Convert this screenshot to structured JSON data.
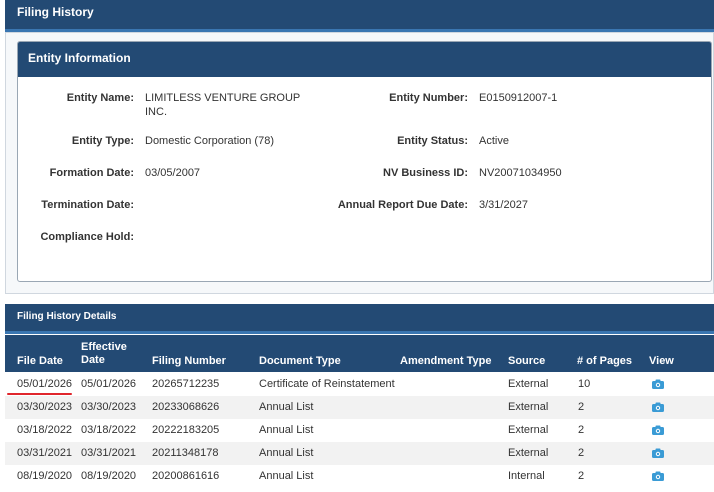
{
  "page_title": "Filing History",
  "entity_section": {
    "title": "Entity Information",
    "fields": {
      "entity_name": {
        "label": "Entity Name:",
        "value_line1": "LIMITLESS VENTURE GROUP",
        "value_line2": "INC."
      },
      "entity_number": {
        "label": "Entity Number:",
        "value": "E0150912007-1"
      },
      "entity_type": {
        "label": "Entity Type:",
        "value": "Domestic Corporation (78)"
      },
      "entity_status": {
        "label": "Entity Status:",
        "value": "Active"
      },
      "formation_date": {
        "label": "Formation Date:",
        "value": "03/05/2007"
      },
      "nv_business_id": {
        "label": "NV Business ID:",
        "value": "NV20071034950"
      },
      "termination_date": {
        "label": "Termination Date:",
        "value": ""
      },
      "annual_report_due": {
        "label": "Annual Report Due Date:",
        "value": "3/31/2027"
      },
      "compliance_hold": {
        "label": "Compliance Hold:",
        "value": ""
      }
    }
  },
  "details_section": {
    "title": "Filing History Details",
    "columns": {
      "file_date": "File Date",
      "effective_date_1": "Effective",
      "effective_date_2": "Date",
      "filing_number": "Filing Number",
      "document_type": "Document Type",
      "amendment_type": "Amendment Type",
      "source": "Source",
      "pages": "# of Pages",
      "view": "View"
    },
    "rows": [
      {
        "file_date": "05/01/2026",
        "effective_date": "05/01/2026",
        "filing_number": "20265712235",
        "document_type": "Certificate of Reinstatement",
        "amendment_type": "",
        "source": "External",
        "pages": "10"
      },
      {
        "file_date": "03/30/2023",
        "effective_date": "03/30/2023",
        "filing_number": "20233068626",
        "document_type": "Annual List",
        "amendment_type": "",
        "source": "External",
        "pages": "2"
      },
      {
        "file_date": "03/18/2022",
        "effective_date": "03/18/2022",
        "filing_number": "20222183205",
        "document_type": "Annual List",
        "amendment_type": "",
        "source": "External",
        "pages": "2"
      },
      {
        "file_date": "03/31/2021",
        "effective_date": "03/31/2021",
        "filing_number": "20211348178",
        "document_type": "Annual List",
        "amendment_type": "",
        "source": "External",
        "pages": "2"
      },
      {
        "file_date": "08/19/2020",
        "effective_date": "08/19/2020",
        "filing_number": "20200861616",
        "document_type": "Annual List",
        "amendment_type": "",
        "source": "Internal",
        "pages": "2"
      }
    ]
  },
  "colors": {
    "header_bg": "#234a74",
    "accent_strip": "#3a76b1",
    "camera_icon": "#3a9bd5",
    "annotation_underline": "#e0262c"
  },
  "icons": {
    "view": "camera-icon"
  }
}
